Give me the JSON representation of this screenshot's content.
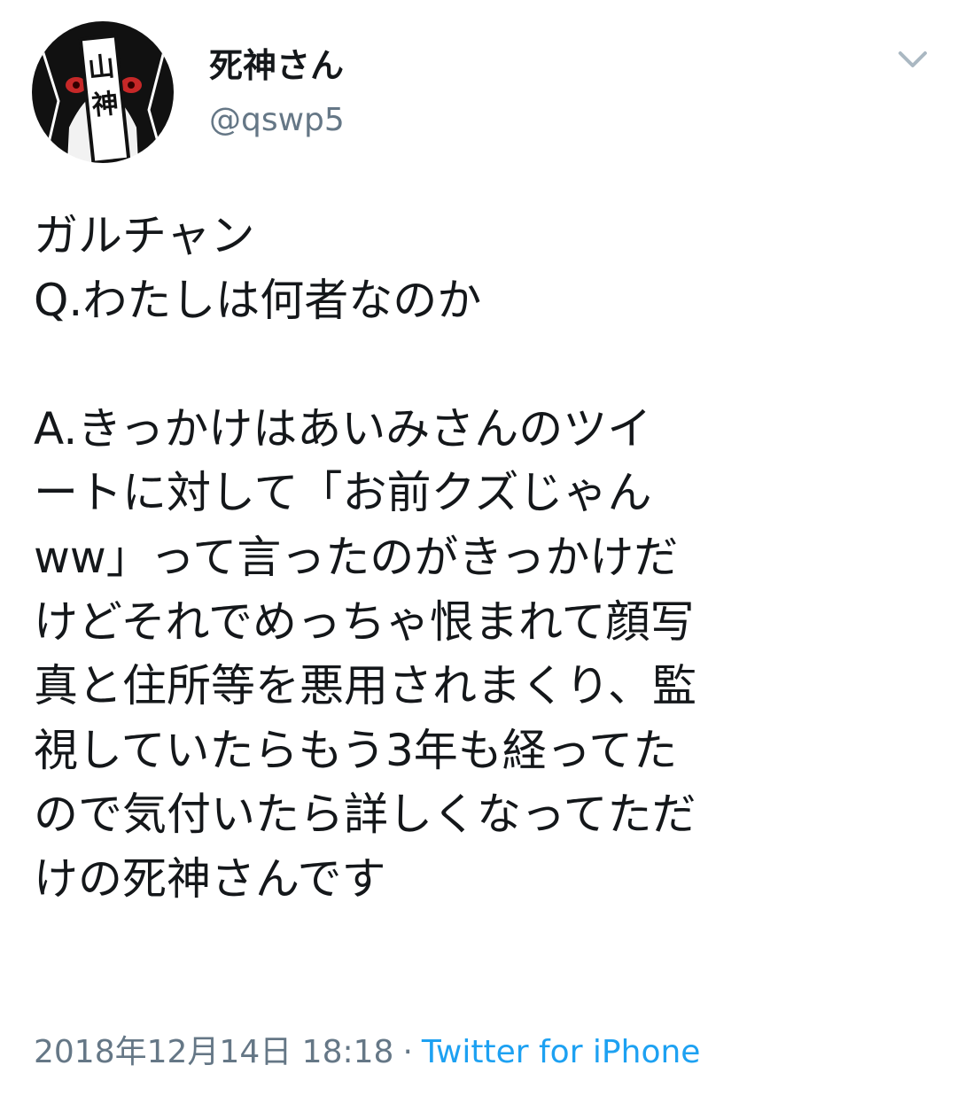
{
  "tweet": {
    "display_name": "死神さん",
    "handle": "@qswp5",
    "avatar_lettering": [
      "山",
      "神"
    ],
    "text_lines": [
      "ガルチャン",
      "Q.わたしは何者なのか",
      "",
      "A.きっかけはあいみさんのツイ",
      "ートに対して「お前クズじゃん",
      "ww」って言ったのがきっかけだ",
      "けどそれでめっちゃ恨まれて顔写",
      "真と住所等を悪用されまくり、監",
      "視していたらもう3年も経ってた",
      "ので気付いたら詳しくなってただ",
      "けの死神さんです"
    ],
    "timestamp": "2018年12月14日 18:18",
    "separator": "·",
    "source": "Twitter for iPhone"
  },
  "icons": {
    "menu": "chevron-down-icon",
    "avatar": "avatar"
  },
  "colors": {
    "text": "#14171a",
    "secondary": "#657786",
    "link": "#1da1f2",
    "caret": "#aab8c2"
  }
}
